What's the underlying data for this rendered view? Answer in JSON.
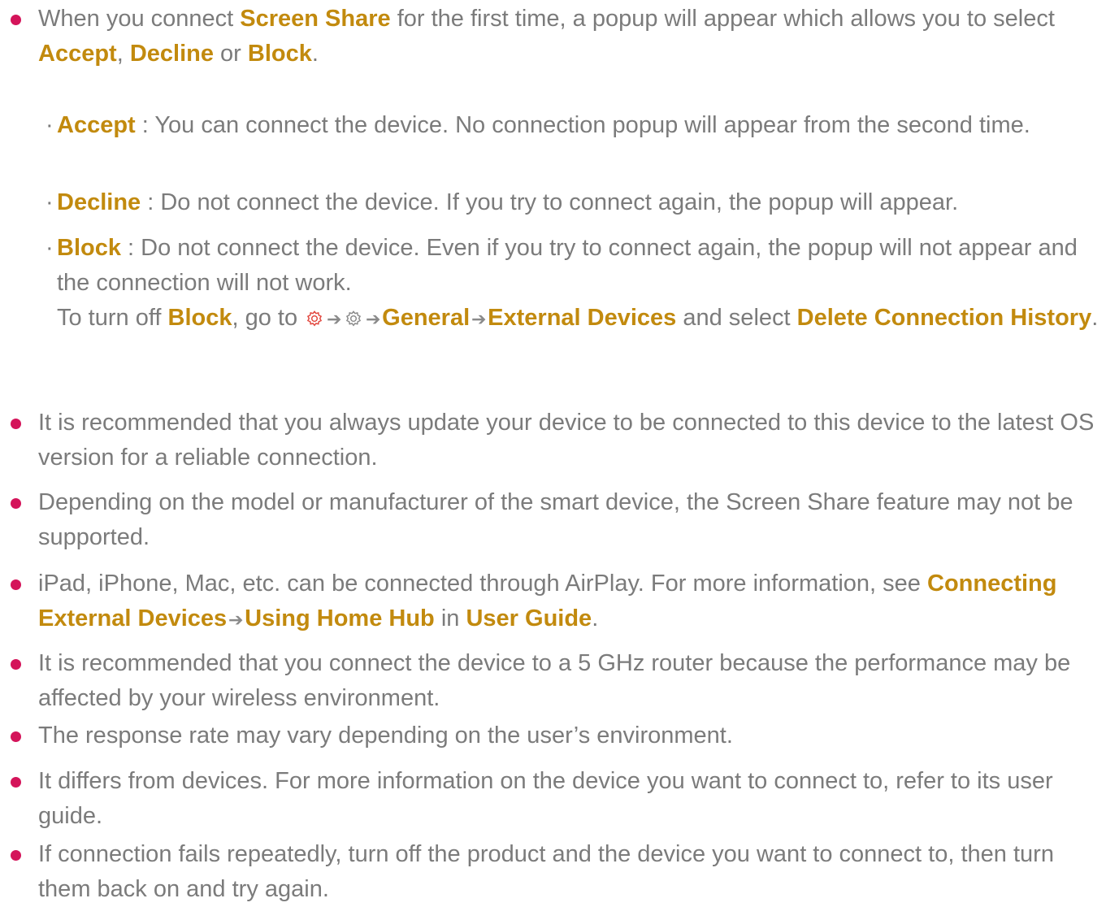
{
  "colors": {
    "text": "#7b7b7b",
    "highlight": "#c28a0e",
    "bullet": "#d4145a",
    "gear_red": "#e2463d",
    "gear_gray": "#8a8a8a"
  },
  "icons": {
    "gear_red": "settings-gear-red-icon",
    "gear_gray": "settings-gear-gray-icon",
    "arrow": "arrow-right-icon"
  },
  "b1": {
    "t1": "When you connect ",
    "h1": "Screen Share",
    "t2": " for the first time, a popup will appear which allows you to select ",
    "h2": "Accept",
    "t3": ", ",
    "h3": "Decline",
    "t4": " or ",
    "h4": "Block",
    "t5": "."
  },
  "sub_marker": "·",
  "arrow_glyph": "➔",
  "s1": {
    "h1": "Accept",
    "t1": " : You can connect the device. No connection popup will appear from the second time."
  },
  "s2": {
    "h1": "Decline",
    "t1": " : Do not connect the device. If you try to connect again, the popup will appear."
  },
  "s3": {
    "h1": "Block",
    "t1": " : Do not connect the device. Even if you try to connect again, the popup will not appear and the connection will not work.",
    "t2": "To turn off ",
    "h2": "Block",
    "t3": ", go to ",
    "h3": "General",
    "h4": "External Devices",
    "t4": " and select ",
    "h5": "Delete Connection History",
    "t5": "."
  },
  "b2": {
    "t1": "It is recommended that you always update your device to be connected to this device to the latest OS version for a reliable connection."
  },
  "b3": {
    "t1": "Depending on the model or manufacturer of the smart device, the Screen Share feature may not be supported."
  },
  "b4": {
    "t1": "iPad, iPhone, Mac, etc. can be connected through AirPlay. For more information, see ",
    "h1": "Connecting External Devices",
    "h2": "Using Home Hub",
    "t2": " in ",
    "h3": "User Guide",
    "t3": "."
  },
  "b5": {
    "t1": "It is recommended that you connect the device to a 5 GHz router because the performance may be affected by your wireless environment."
  },
  "b6": {
    "t1": "The response rate may vary depending on the user’s environment."
  },
  "b7": {
    "t1": "It differs from devices. For more information on the device you want to connect to, refer to its user guide."
  },
  "b8": {
    "t1": "If connection fails repeatedly, turn off the product and the device you want to connect to, then turn them back on and try again."
  }
}
